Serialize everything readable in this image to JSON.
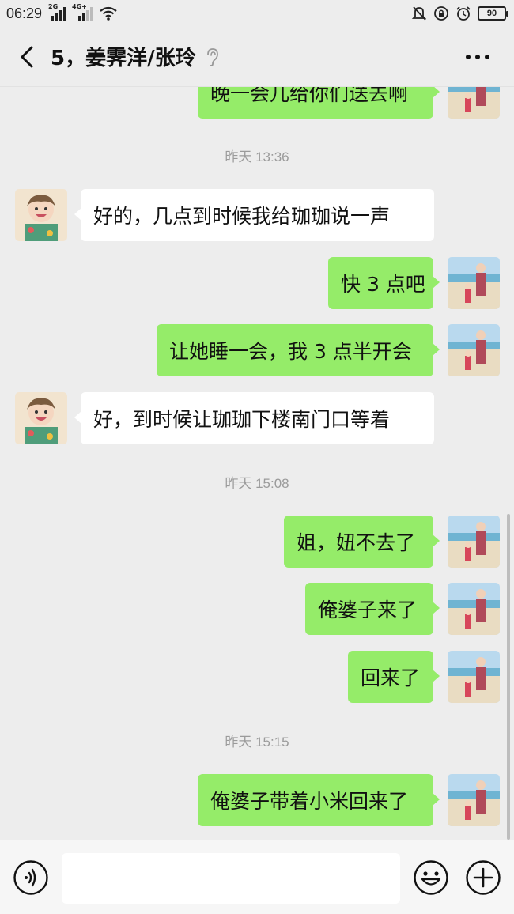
{
  "status_bar": {
    "time": "06:29",
    "network1": "2G",
    "network2": "4G+",
    "battery": "90"
  },
  "header": {
    "title": "5，姜霁洋/张玲"
  },
  "messages": [
    {
      "type": "out",
      "text": "晚一会儿给你们送去啊"
    },
    {
      "type": "time",
      "text": "昨天 13:36"
    },
    {
      "type": "in",
      "text": "好的，几点到时候我给珈珈说一声"
    },
    {
      "type": "out",
      "text": "快 3 点吧"
    },
    {
      "type": "out",
      "text": "让她睡一会，我 3 点半开会"
    },
    {
      "type": "in",
      "text": "好，到时候让珈珈下楼南门口等着"
    },
    {
      "type": "time",
      "text": "昨天 15:08"
    },
    {
      "type": "out",
      "text": "姐，妞不去了"
    },
    {
      "type": "out",
      "text": "俺婆子来了"
    },
    {
      "type": "out",
      "text": "回来了"
    },
    {
      "type": "time",
      "text": "昨天 15:15"
    },
    {
      "type": "out",
      "text": "俺婆子带着小米回来了"
    }
  ],
  "input": {
    "value": "",
    "placeholder": ""
  },
  "icons": {
    "back": "chevron-left-icon",
    "earpiece": "ear-icon",
    "more": "more-icon",
    "voice": "voice-icon",
    "emoji": "emoji-icon",
    "plus": "plus-icon"
  },
  "colors": {
    "background": "#ededed",
    "outgoing_bubble": "#95ec69",
    "incoming_bubble": "#ffffff",
    "timestamp": "#9b9b9b"
  }
}
